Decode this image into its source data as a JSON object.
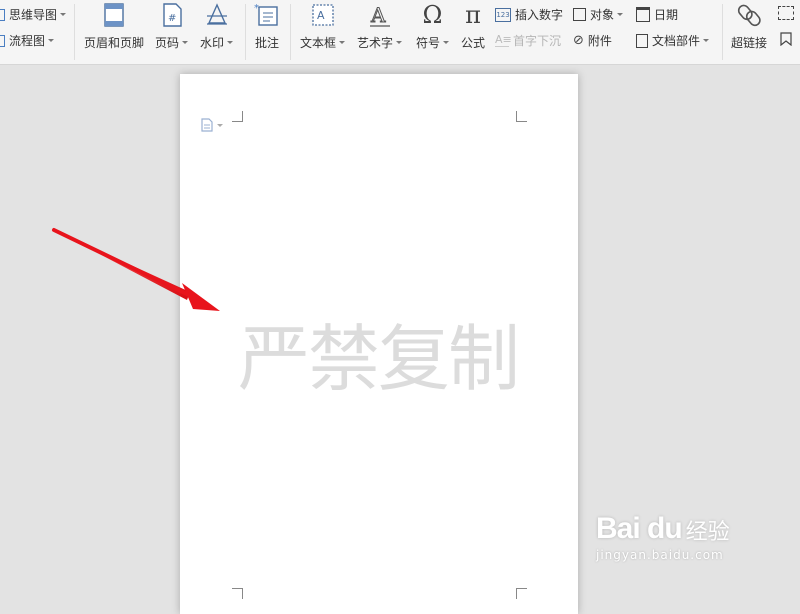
{
  "ribbon": {
    "mindmap_label": "思维导图",
    "flowchart_label": "流程图",
    "header_footer_label": "页眉和页脚",
    "page_number_label": "页码",
    "watermark_label": "水印",
    "comment_label": "批注",
    "textbox_label": "文本框",
    "wordart_label": "艺术字",
    "symbol_label": "符号",
    "formula_label": "公式",
    "insert_number_label": "插入数字",
    "dropcap_label": "首字下沉",
    "object_label": "对象",
    "attachment_label": "附件",
    "date_label": "日期",
    "doc_parts_label": "文档部件",
    "hyperlink_label": "超链接"
  },
  "document": {
    "watermark_text": "严禁复制"
  },
  "overlay": {
    "arrow_color": "#e8141c",
    "baidu_logo_text": "Bai du",
    "baidu_cn_text": "经验",
    "baidu_url": "jingyan.baidu.com"
  }
}
